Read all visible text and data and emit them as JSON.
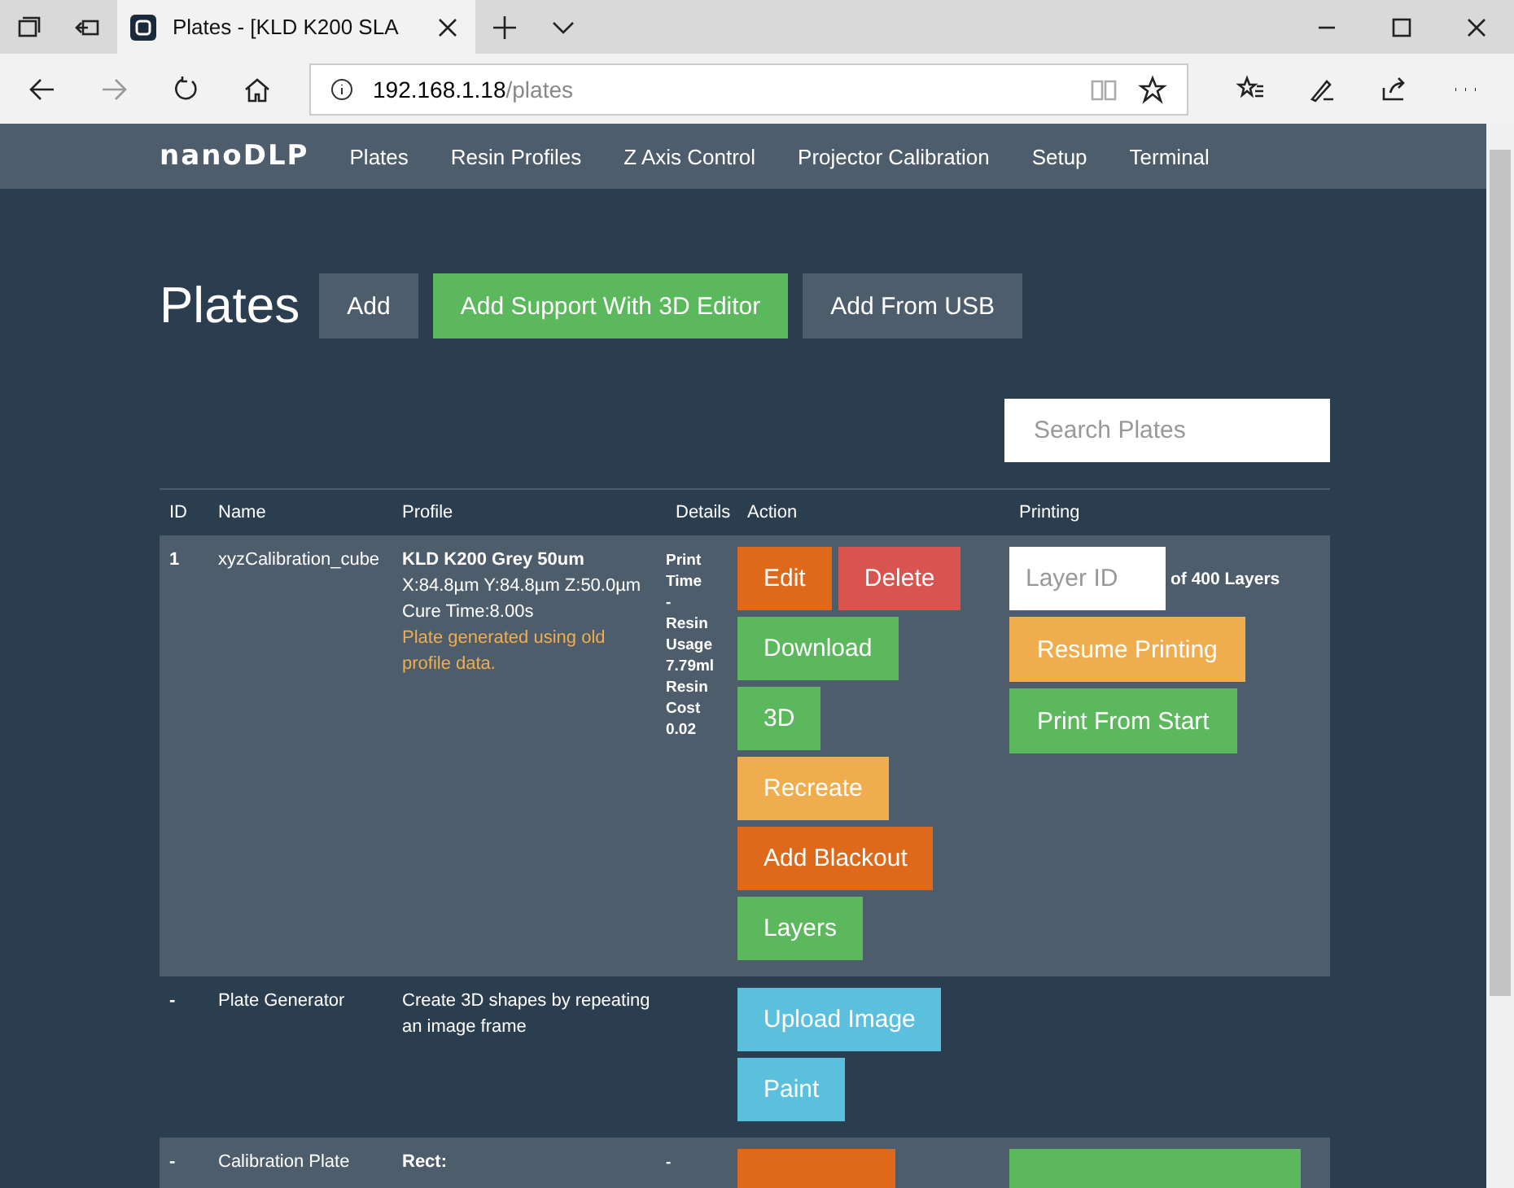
{
  "browser": {
    "tab_title": "Plates - [KLD K200 SLA",
    "url_host": "192.168.1.18",
    "url_path": "/plates"
  },
  "navbar": {
    "logo": "nanoDLP",
    "items": [
      "Plates",
      "Resin Profiles",
      "Z Axis Control",
      "Projector Calibration",
      "Setup",
      "Terminal"
    ]
  },
  "header": {
    "title": "Plates",
    "buttons": [
      {
        "label": "Add",
        "color": "#4e5d6c"
      },
      {
        "label": "Add Support With 3D Editor",
        "color": "#5cb85c"
      },
      {
        "label": "Add From USB",
        "color": "#4e5d6c"
      }
    ]
  },
  "search": {
    "placeholder": "Search Plates"
  },
  "table": {
    "columns": [
      "ID",
      "Name",
      "Profile",
      "Details",
      "Action",
      "Printing"
    ],
    "rows": [
      {
        "id": "1",
        "name": "xyzCalibration_cube",
        "profile": [
          "KLD K200 Grey 50um",
          "X:84.8µm Y:84.8µm Z:50.0µm",
          "Cure Time:8.00s"
        ],
        "warning": "Plate generated using old profile data.",
        "details": [
          "Print Time",
          "-",
          "Resin Usage",
          "7.79ml",
          "Resin Cost",
          "0.02"
        ],
        "actions": [
          [
            {
              "label": "Edit",
              "color": "#df691a"
            },
            {
              "label": "Delete",
              "color": "#d9534f"
            }
          ],
          [
            {
              "label": "Download",
              "color": "#5cb85c"
            }
          ],
          [
            {
              "label": "3D",
              "color": "#5cb85c"
            }
          ],
          [
            {
              "label": "Recreate",
              "color": "#f0ad4e"
            }
          ],
          [
            {
              "label": "Add Blackout",
              "color": "#df691a"
            }
          ],
          [
            {
              "label": "Layers",
              "color": "#5cb85c"
            }
          ]
        ],
        "printing": {
          "layer_placeholder": "Layer ID",
          "layers_text": "of 400 Layers",
          "buttons": [
            {
              "label": "Resume Printing",
              "color": "#f0ad4e"
            },
            {
              "label": "Print From Start",
              "color": "#5cb85c"
            }
          ]
        }
      },
      {
        "id": "-",
        "name": "Plate Generator",
        "description": "Create 3D shapes by repeating an image frame",
        "actions": [
          [
            {
              "label": "Upload Image",
              "color": "#5bc0de"
            }
          ],
          [
            {
              "label": "Paint",
              "color": "#5bc0de"
            }
          ]
        ]
      },
      {
        "id": "-",
        "name": "Calibration Plate",
        "profile": [
          "Rect:"
        ],
        "details": [
          "-"
        ],
        "actions": [
          [
            {
              "color": "#df691a"
            }
          ]
        ],
        "printing": {
          "buttons": [
            {
              "color": "#5cb85c"
            }
          ]
        }
      }
    ]
  }
}
